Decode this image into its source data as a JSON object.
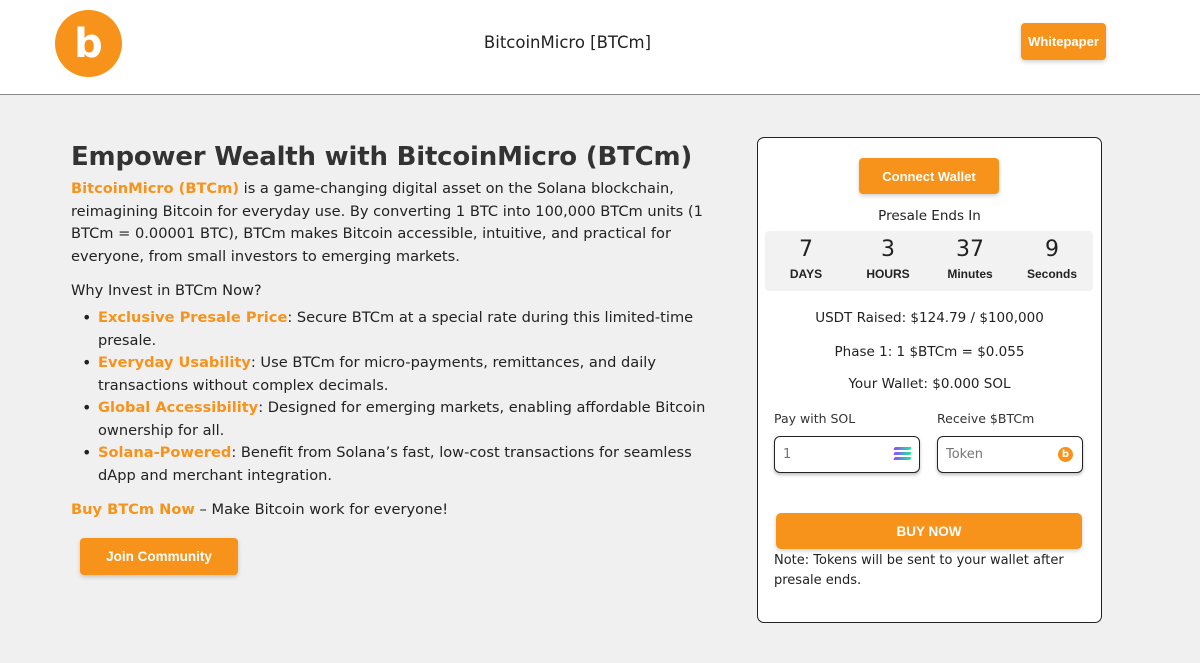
{
  "header": {
    "logo_letter": "b",
    "site_title": "BitcoinMicro [BTCm]",
    "whitepaper_label": "Whitepaper"
  },
  "hero": {
    "headline": "Empower Wealth with BitcoinMicro (BTCm)",
    "intro_brand": "BitcoinMicro (BTCm)",
    "intro_text": " is a game-changing digital asset on the Solana blockchain, reimagining Bitcoin for everyday use. By converting 1 BTC into 100,000 BTCm units (1 BTCm = 0.00001 BTC), BTCm makes Bitcoin accessible, intuitive, and practical for everyone, from small investors to emerging markets.",
    "why_heading": "Why Invest in BTCm Now?",
    "benefits": [
      {
        "title": "Exclusive Presale Price",
        "text": ": Secure BTCm at a special rate during this limited-time presale."
      },
      {
        "title": "Everyday Usability",
        "text": ": Use BTCm for micro-payments, remittances, and daily transactions without complex decimals."
      },
      {
        "title": "Global Accessibility",
        "text": ": Designed for emerging markets, enabling affordable Bitcoin ownership for all."
      },
      {
        "title": "Solana-Powered",
        "text": ": Benefit from Solana’s fast, low-cost transactions for seamless dApp and merchant integration."
      }
    ],
    "cta_link": "Buy BTCm Now",
    "cta_text": " – Make Bitcoin work for everyone!",
    "join_label": "Join Community"
  },
  "presale": {
    "connect_label": "Connect Wallet",
    "ends_label": "Presale Ends In",
    "countdown": [
      {
        "value": "7",
        "unit": "DAYS"
      },
      {
        "value": "3",
        "unit": "HOURS"
      },
      {
        "value": "37",
        "unit": "Minutes"
      },
      {
        "value": "9",
        "unit": "Seconds"
      }
    ],
    "raised": "USDT Raised: $124.79 / $100,000",
    "phase": "Phase 1: 1 $BTCm = $0.055",
    "wallet": "Your Wallet: $0.000 SOL",
    "pay_label": "Pay with SOL",
    "pay_placeholder": "1",
    "receive_label": "Receive $BTCm",
    "receive_placeholder": "Token",
    "token_icon_letter": "b",
    "buy_label": "BUY NOW",
    "note": "Note: Tokens will be sent to your wallet after presale ends."
  },
  "colors": {
    "accent": "#f7931a",
    "background": "#f0f0f0",
    "card": "#ffffff"
  },
  "icons": {
    "pay_field": "solana-icon",
    "receive_field": "btcm-token-icon"
  }
}
